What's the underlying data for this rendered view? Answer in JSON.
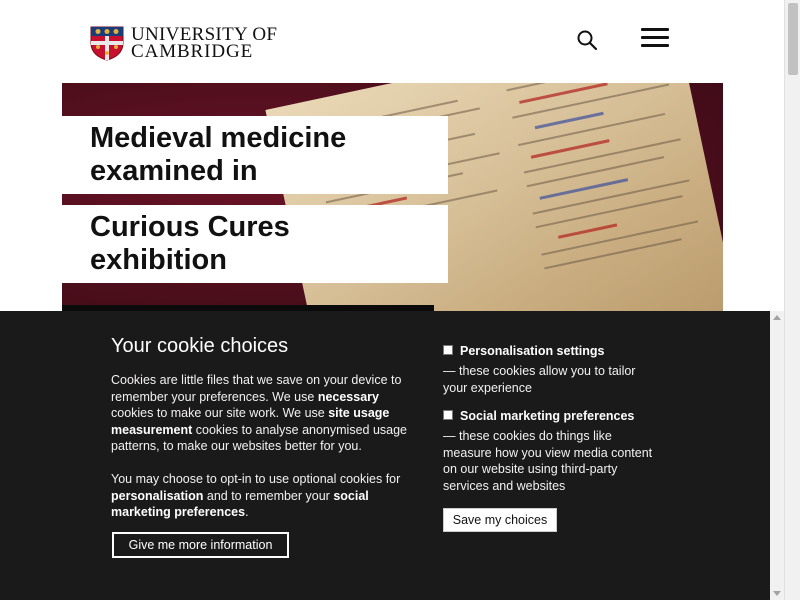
{
  "header": {
    "logo_line1": "UNIVERSITY OF",
    "logo_line2": "CAMBRIDGE",
    "icons": {
      "search": "search-icon",
      "menu": "hamburger-menu-icon",
      "logo": "university-shield-icon"
    }
  },
  "hero": {
    "title_line1": "Medieval medicine examined in",
    "title_line2": "Curious Cures exhibition",
    "colors": {
      "background": "#4d0e1c",
      "parchment": "#d8c19a"
    }
  },
  "cookie_banner": {
    "heading": "Your cookie choices",
    "p1": {
      "t1": "Cookies are little files that we save on your device to remember your preferences. We use ",
      "b1": "necessary",
      "t2": " cookies to make our site work. We use ",
      "b2": "site usage measurement",
      "t3": " cookies to analyse anonymised usage patterns, to make our websites better for you."
    },
    "p2": {
      "t1": "You may choose to opt-in to use optional cookies for ",
      "b1": "personalisation",
      "t2": " and to remember your ",
      "b2": "social marketing preferences",
      "t3": "."
    },
    "more_info_button": "Give me more information",
    "options": [
      {
        "label": "Personalisation settings",
        "description": "— these cookies allow you to tailor your experience",
        "checked": false
      },
      {
        "label": "Social marketing preferences",
        "description": "— these cookies do things like measure how you view media content on our website using third-party services and websites",
        "checked": false
      }
    ],
    "save_button": "Save my choices",
    "colors": {
      "background": "#1b1a1a",
      "text": "#ffffff"
    }
  }
}
